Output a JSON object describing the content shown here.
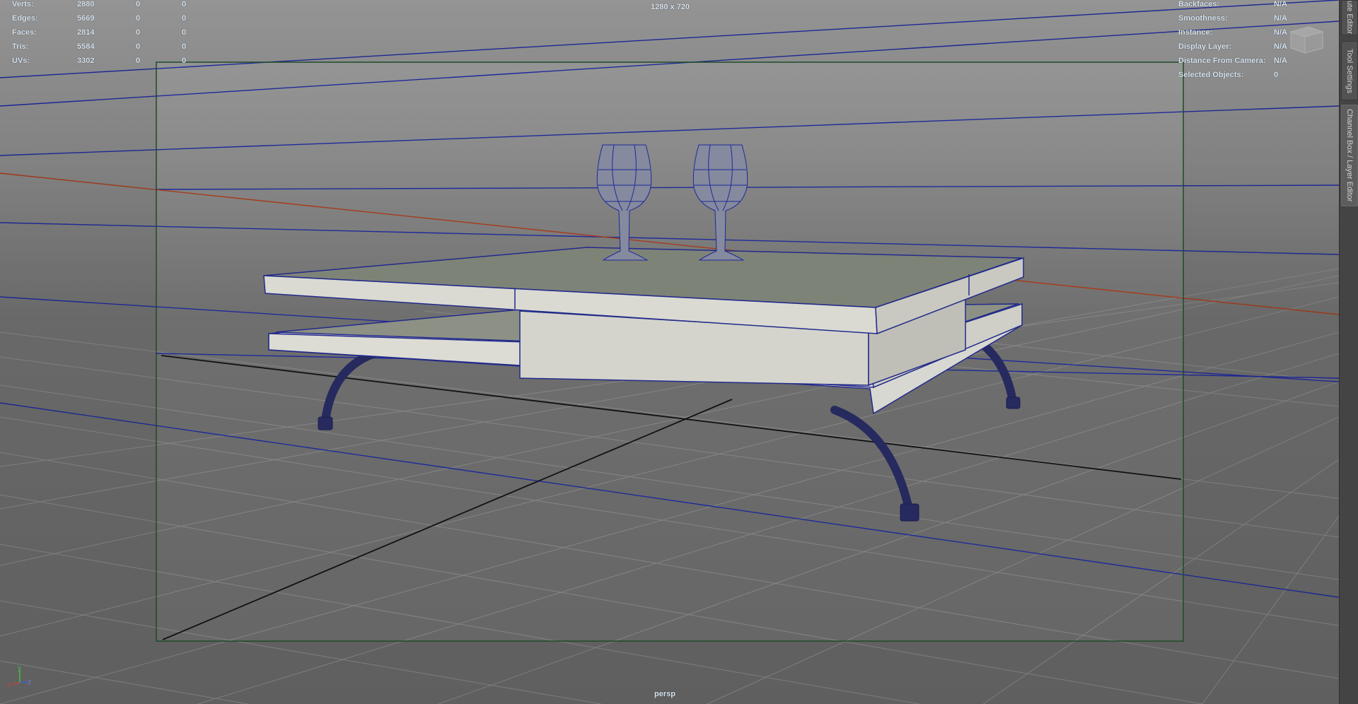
{
  "viewport": {
    "resolution_gate_label": "1280 x 720",
    "camera_name": "persp"
  },
  "heads_up_poly_count": [
    {
      "label": "Verts:",
      "total": "2880",
      "selected": "0",
      "components": "0"
    },
    {
      "label": "Edges:",
      "total": "5669",
      "selected": "0",
      "components": "0"
    },
    {
      "label": "Faces:",
      "total": "2814",
      "selected": "0",
      "components": "0"
    },
    {
      "label": "Tris:",
      "total": "5584",
      "selected": "0",
      "components": "0"
    },
    {
      "label": "UVs:",
      "total": "3302",
      "selected": "0",
      "components": "0"
    }
  ],
  "heads_up_object_details": [
    {
      "label": "Backfaces:",
      "value": "N/A"
    },
    {
      "label": "Smoothness:",
      "value": "N/A"
    },
    {
      "label": "Instance:",
      "value": "N/A"
    },
    {
      "label": "Display Layer:",
      "value": "N/A"
    },
    {
      "label": "Distance From Camera:",
      "value": "N/A"
    },
    {
      "label": "Selected Objects:",
      "value": "0"
    }
  ],
  "side_tabs": [
    {
      "label": "ute Editor"
    },
    {
      "label": "Tool Settings"
    },
    {
      "label": "Channel Box / Layer Editor"
    }
  ],
  "axis_indicator": {
    "x": "x",
    "y": "y",
    "z": "z"
  },
  "colors": {
    "hud_text": "#d9e6f2",
    "wireframe": "#2a2f8a",
    "grid_line": "#8e8e8e",
    "gate_border": "#1f4d2a",
    "x_axis_line": "#a83a1a"
  }
}
